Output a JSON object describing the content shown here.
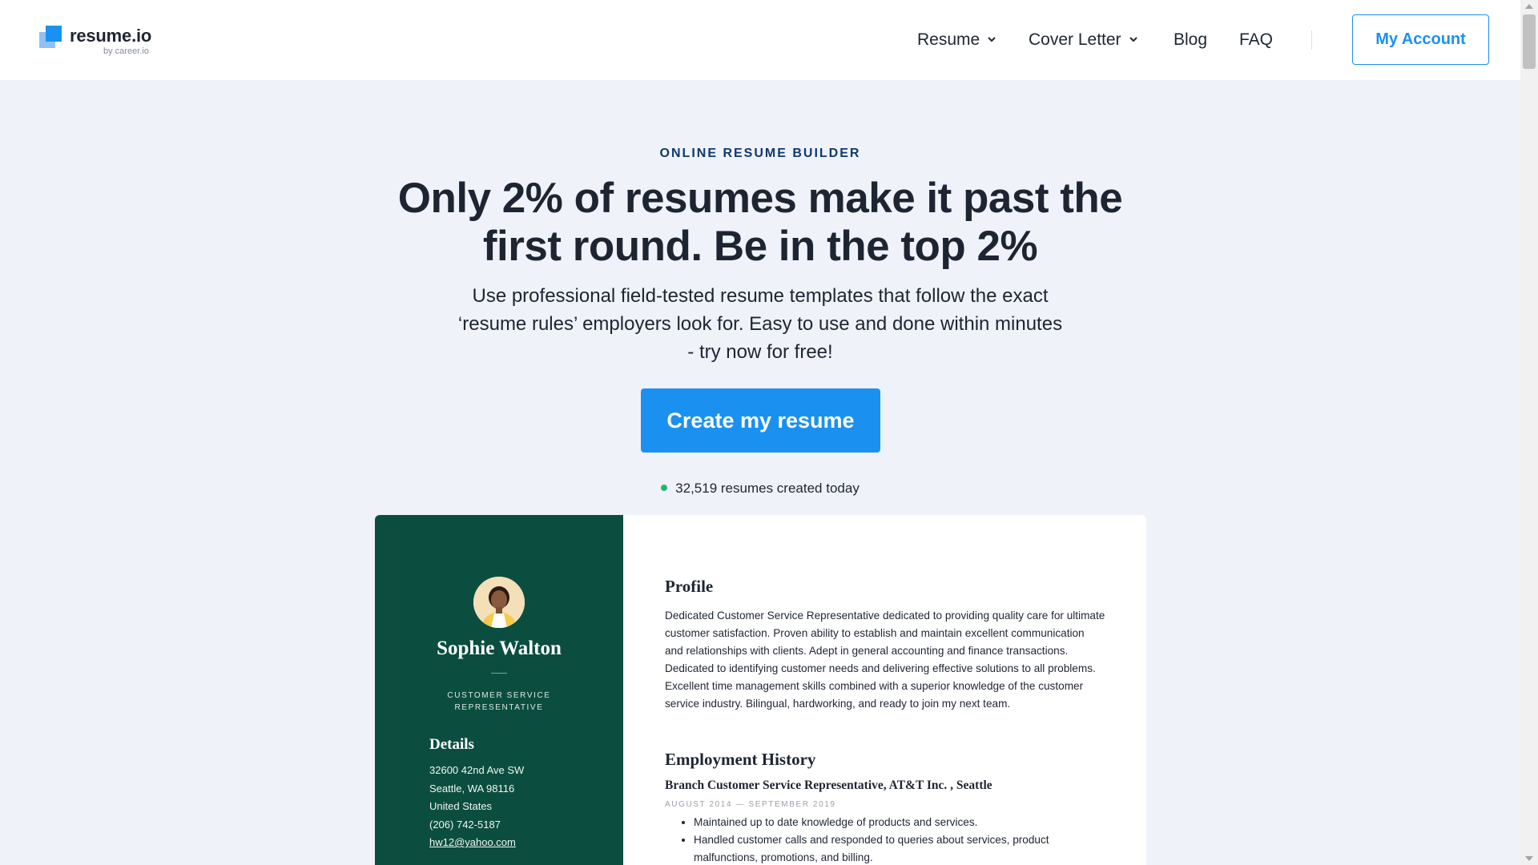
{
  "header": {
    "logo_text": "resume.io",
    "logo_sub": "by career.io",
    "nav": [
      {
        "label": "Resume",
        "has_dropdown": true
      },
      {
        "label": "Cover Letter",
        "has_dropdown": true
      },
      {
        "label": "Blog",
        "has_dropdown": false
      },
      {
        "label": "FAQ",
        "has_dropdown": false
      }
    ],
    "account_label": "My Account"
  },
  "hero": {
    "eyebrow": "ONLINE RESUME BUILDER",
    "headline": "Only 2% of resumes make it past the first round. Be in the top 2%",
    "subtext": "Use professional field-tested resume templates that follow the exact ‘resume rules’ employers look for. Easy to use and done within minutes - try now for free!",
    "cta_label": "Create my resume",
    "counter": "32,519 resumes created today"
  },
  "resume_preview": {
    "name": "Sophie Walton",
    "title": "CUSTOMER SERVICE REPRESENTATIVE",
    "details_heading": "Details",
    "details": {
      "address1": "32600 42nd Ave SW",
      "address2": "Seattle, WA 98116",
      "country": "United States",
      "phone": "(206) 742-5187",
      "email": "hw12@yahoo.com"
    },
    "profile_heading": "Profile",
    "profile_text": "Dedicated Customer Service Representative dedicated to providing quality care for ultimate customer satisfaction. Proven ability to establish and maintain excellent communication and relationships with clients. Adept in general accounting and finance transactions. Dedicated to identifying customer needs and delivering effective solutions to all problems. Excellent time management skills combined with a superior knowledge of the customer service industry. Bilingual, hardworking, and ready to join my next team.",
    "employment_heading": "Employment History",
    "job_title": "Branch Customer Service Representative, AT&T Inc. , Seattle",
    "job_dates": "AUGUST 2014 — SEPTEMBER 2019",
    "job_bullets": [
      "Maintained up to date knowledge of products and services.",
      "Handled customer calls and responded to queries about services, product malfunctions, promotions, and billing."
    ]
  },
  "colors": {
    "brand_blue": "#1a91f0",
    "sidebar_green": "#0b4e3f",
    "page_bg": "#eff2f9",
    "status_green": "#21b66e"
  }
}
